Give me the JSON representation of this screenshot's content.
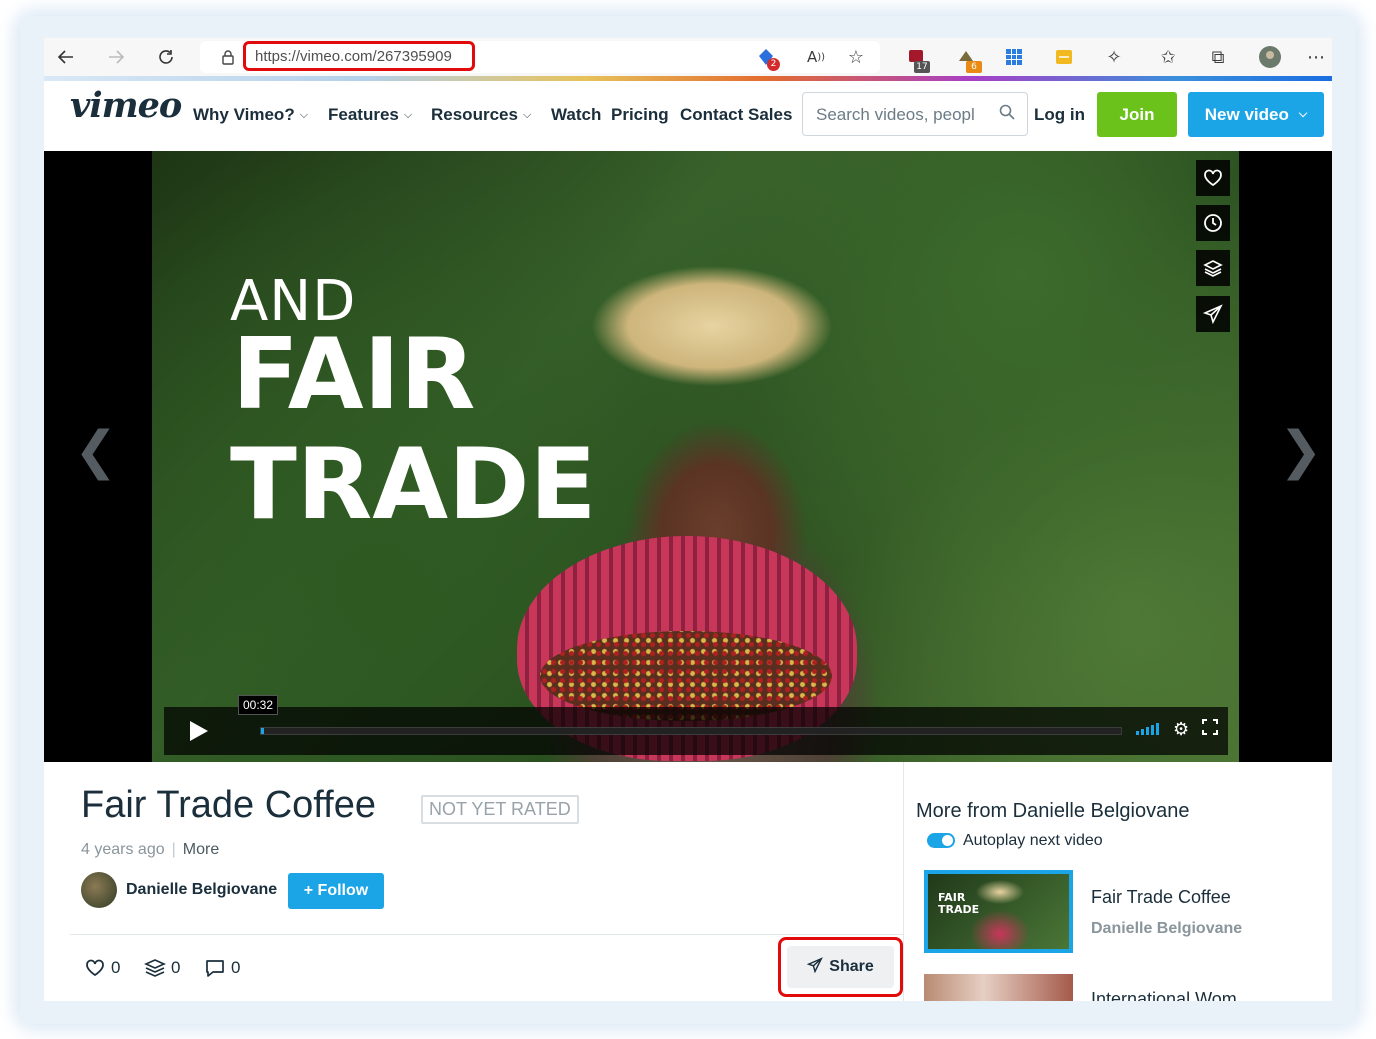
{
  "browser": {
    "url": "https://vimeo.com/267395909",
    "badges": {
      "shield": "2",
      "ext_red": "17",
      "ext_yellow": "6"
    },
    "icons": [
      "back-icon",
      "forward-icon",
      "refresh-icon",
      "lock-icon",
      "read-aloud-icon",
      "add-favorite-icon",
      "extensions-icon",
      "favorites-icon",
      "collections-icon",
      "profile-avatar",
      "more-icon"
    ]
  },
  "header": {
    "logo": "vimeo",
    "nav": [
      {
        "label": "Why Vimeo?",
        "dropdown": true
      },
      {
        "label": "Features",
        "dropdown": true
      },
      {
        "label": "Resources",
        "dropdown": true
      },
      {
        "label": "Watch",
        "dropdown": false
      },
      {
        "label": "Pricing",
        "dropdown": false
      },
      {
        "label": "Contact Sales",
        "dropdown": false
      }
    ],
    "search_placeholder": "Search videos, peopl",
    "login_label": "Log in",
    "join_label": "Join",
    "new_video_label": "New video",
    "colors": {
      "join": "#6bc21b",
      "new_video": "#1ba4e6"
    }
  },
  "player": {
    "overlay": {
      "line1": "AND",
      "line2": "FAIR",
      "line3": "TRADE"
    },
    "timecode": "00:32",
    "progress_fraction": 0.003,
    "side_actions": [
      "heart-icon",
      "clock-icon",
      "layers-icon",
      "share-icon"
    ]
  },
  "video": {
    "title": "Fair Trade Coffee",
    "rating_badge": "NOT YET RATED",
    "age": "4 years ago",
    "separator": "|",
    "more_label": "More",
    "author": "Danielle Belgiovane",
    "follow_label": "+ Follow",
    "stats": {
      "likes": "0",
      "collections": "0",
      "comments": "0"
    },
    "share_label": "Share"
  },
  "sidebar": {
    "heading": "More from Danielle Belgiovane",
    "autoplay_label": "Autoplay next video",
    "autoplay_on": true,
    "items": [
      {
        "title": "Fair Trade Coffee",
        "author": "Danielle Belgiovane",
        "thumb_text_1": "FAIR",
        "thumb_text_2": "TRADE"
      },
      {
        "title": "International Wom"
      }
    ]
  }
}
